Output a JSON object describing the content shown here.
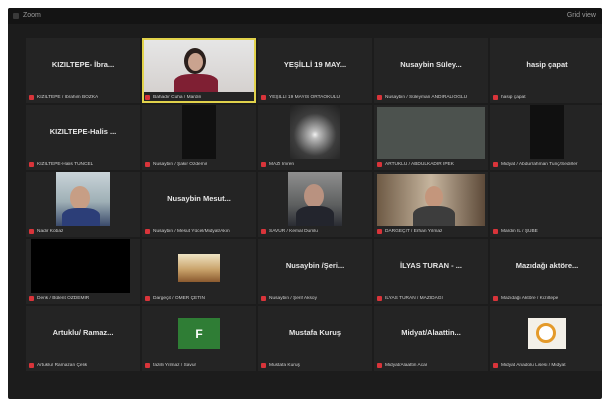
{
  "window": {
    "title": "Zoom",
    "view_label": "Grid view"
  },
  "tiles": [
    {
      "big": "KIZILTEPE- İbra...",
      "name": "KIZILTEPE / İbrahim BOZKA"
    },
    {
      "big": "",
      "name": "Bahadır Cuha / Mardin"
    },
    {
      "big": "YEŞİLLİ 19 MAY...",
      "name": "YEŞİLLİ 19 MAYIS ORTAOKULU"
    },
    {
      "big": "Nusaybin Süley...",
      "name": "Nusaybin / Süleyman ANDIRALIOĞLU"
    },
    {
      "big": "hasip çapat",
      "name": "hasip çapat"
    },
    {
      "big": "KIZILTEPE-Halis ...",
      "name": "KIZILTEPE-Halis TUNCEL"
    },
    {
      "big": "",
      "name": "Nusaybin / Şakir Özdemir"
    },
    {
      "big": "",
      "name": "MAZI İmren"
    },
    {
      "big": "",
      "name": "ARTUKLU / ABDULKADİR İPEK"
    },
    {
      "big": "",
      "name": "Midyat / Abdurrahman Tunç/Sedirler"
    },
    {
      "big": "",
      "name": "Nadir Kobaz"
    },
    {
      "big": "Nusaybin Mesut...",
      "name": "Nusaybin / Mesut Yücel/Midyat/Akın"
    },
    {
      "big": "",
      "name": "SAVUR / Kemal Dumlu"
    },
    {
      "big": "",
      "name": "DARGEÇİT / Erhan Yılmaz"
    },
    {
      "big": "",
      "name": "Mardin İL / ŞUBE"
    },
    {
      "big": "",
      "name": "Derik / Bülent ÖZDEMİR"
    },
    {
      "big": "",
      "name": "Dargeçit / ÖMER ÇETİN"
    },
    {
      "big": "Nusaybin /Şeri...",
      "name": "Nusaybin / Şerif Aksoy"
    },
    {
      "big": "İLYAS TURAN - ...",
      "name": "İLYAS TURAN / MAZIDAĞI"
    },
    {
      "big": "Mazıdağı aktöre...",
      "name": "Mazıdağı Aktöre / Kızıltepe"
    },
    {
      "big": "Artuklu/ Ramaz...",
      "name": "Artuklu/ Ramazan Çelik"
    },
    {
      "big": "",
      "name": "fazilli Yılmaz / Savur"
    },
    {
      "big": "Mustafa Kuruş",
      "name": "Mustafa Kuruş"
    },
    {
      "big": "Midyat/Alaattin...",
      "name": "Midyat/Alaattin Acar"
    },
    {
      "big": "",
      "name": "Midyat Anadolu Lisesi / Midyat"
    }
  ],
  "icons": {
    "mic": "mic-muted-icon",
    "app": "zoom-app-icon"
  },
  "colors": {
    "active_border": "#e1d24b",
    "muted_mic": "#d9343a",
    "tile_bg": "#242424"
  }
}
